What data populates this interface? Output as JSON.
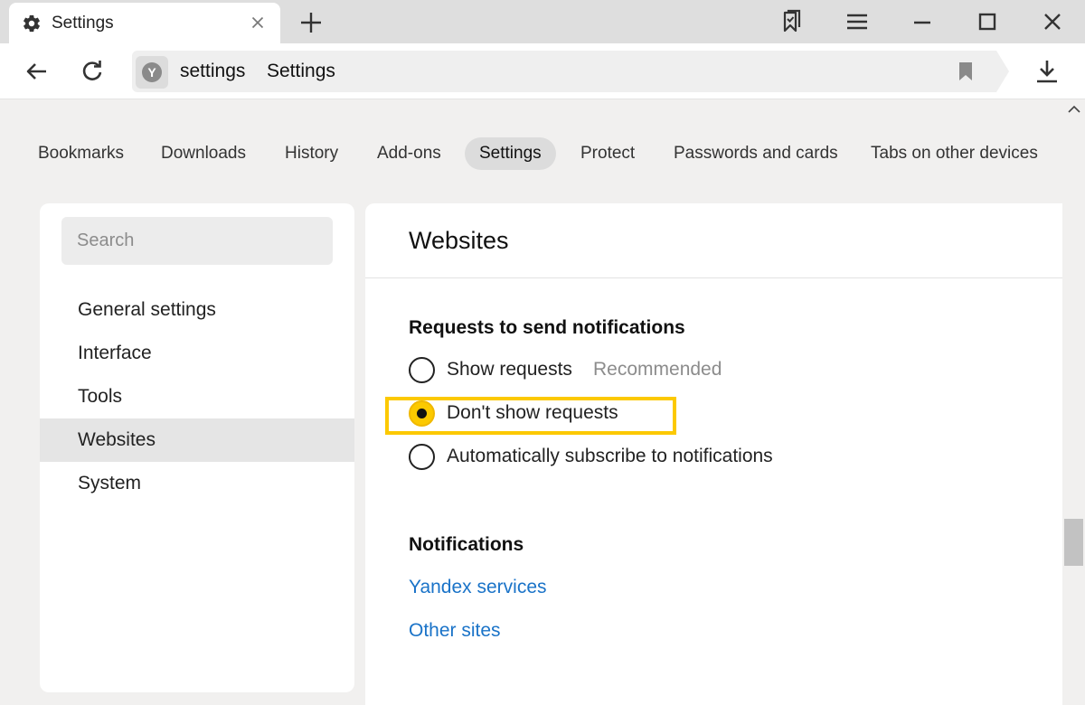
{
  "tab": {
    "title": "Settings",
    "icon": "gear-icon"
  },
  "window_controls": [
    "collections-icon",
    "menu-icon",
    "minimize-icon",
    "maximize-icon",
    "close-window-icon"
  ],
  "toolbar": {
    "url_host": "settings",
    "url_title": "Settings",
    "site_badge": "Y"
  },
  "topnav": {
    "items": [
      "Bookmarks",
      "Downloads",
      "History",
      "Add-ons",
      "Settings",
      "Protect",
      "Passwords and cards",
      "Tabs on other devices"
    ],
    "active": "Settings"
  },
  "sidebar": {
    "search_placeholder": "Search",
    "items": [
      "General settings",
      "Interface",
      "Tools",
      "Websites",
      "System"
    ],
    "active": "Websites"
  },
  "content": {
    "page_title": "Websites",
    "requests_section": {
      "title": "Requests to send notifications",
      "options": [
        {
          "label": "Show requests",
          "hint": "Recommended",
          "selected": false
        },
        {
          "label": "Don't show requests",
          "hint": "",
          "selected": true
        },
        {
          "label": "Automatically subscribe to notifications",
          "hint": "",
          "selected": false
        }
      ]
    },
    "notifications_section": {
      "title": "Notifications",
      "links": [
        "Yandex services",
        "Other sites"
      ]
    }
  },
  "colors": {
    "accent": "#fcc900",
    "link": "#1a73c8",
    "background": "#f1f0ef"
  }
}
